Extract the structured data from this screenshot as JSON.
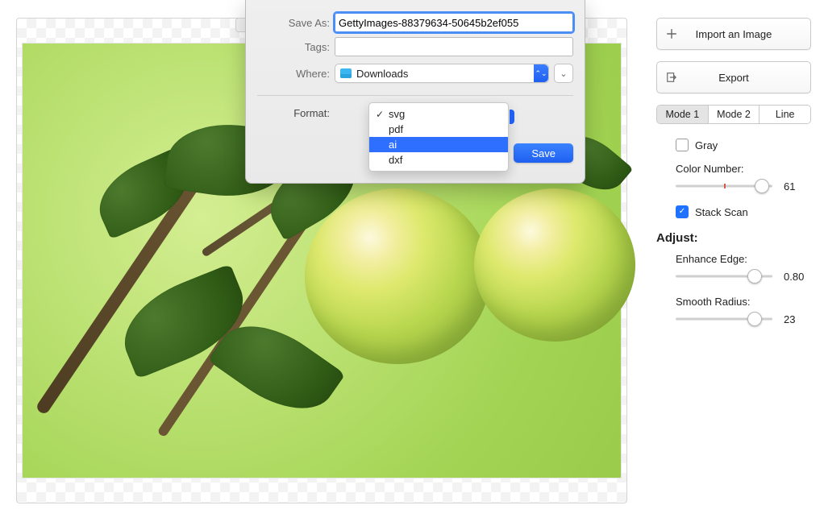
{
  "sidebar": {
    "import_label": "Import an Image",
    "export_label": "Export",
    "modes": [
      "Mode 1",
      "Mode 2",
      "Line"
    ],
    "active_mode_index": 0,
    "gray": {
      "label": "Gray",
      "checked": false
    },
    "color_number": {
      "label": "Color Number:",
      "value": 61,
      "tick_pct": 50,
      "knob_pct": 89
    },
    "stack_scan": {
      "label": "Stack Scan",
      "checked": true
    },
    "adjust_header": "Adjust:",
    "enhance_edge": {
      "label": "Enhance Edge:",
      "value": "0.80",
      "knob_pct": 82
    },
    "smooth_radius": {
      "label": "Smooth Radius:",
      "value": 23,
      "knob_pct": 82
    }
  },
  "dialog": {
    "save_as_label": "Save As:",
    "save_as_value": "GettyImages-88379634-50645b2ef055",
    "tags_label": "Tags:",
    "tags_value": "",
    "where_label": "Where:",
    "where_value": "Downloads",
    "format_label": "Format:",
    "format_options": [
      "svg",
      "pdf",
      "ai",
      "dxf"
    ],
    "format_current_index": 0,
    "format_highlight_index": 2,
    "save_button": "Save"
  }
}
